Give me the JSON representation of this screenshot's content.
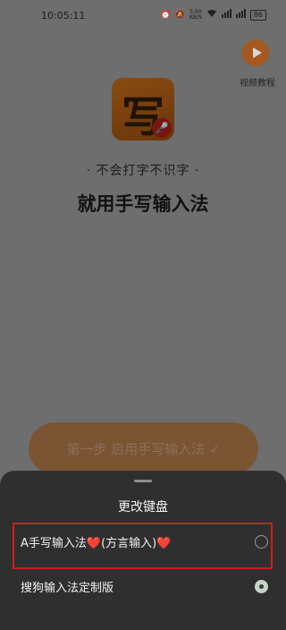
{
  "status_bar": {
    "time": "10:05:11",
    "network_speed_value": "5.00",
    "network_speed_unit": "KB/S",
    "battery": "86"
  },
  "header": {
    "video_tutorial_label": "视频教程"
  },
  "hero": {
    "app_icon_glyph": "写",
    "tagline": "· 不会打字不识字 ·",
    "headline": "就用手写输入法"
  },
  "step_button": {
    "label": "第一步 启用手写输入法 ✓"
  },
  "keyboard_sheet": {
    "title": "更改键盘",
    "options": [
      {
        "label": "A手写输入法❤️(方言输入)❤️",
        "selected": false,
        "highlighted": true
      },
      {
        "label": "搜狗输入法定制版",
        "selected": true,
        "highlighted": false
      }
    ]
  },
  "colors": {
    "accent_orange": "#e07a2c",
    "highlight_red": "#d21b1b",
    "sheet_bg": "#2f2f2f"
  }
}
